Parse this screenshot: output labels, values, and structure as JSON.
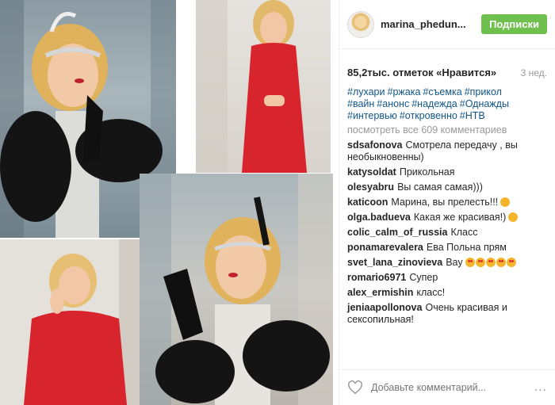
{
  "post": {
    "username": "marina_phedun...",
    "follow_label": "Подписки",
    "likes": "85,2тыс. отметок «Нравится»",
    "date": "3 нед.",
    "hashtags": [
      "#лухари",
      "#ржака",
      "#съемка",
      "#прикол",
      "#вайн",
      "#анонс",
      "#надежда",
      "#Однажды",
      "#интервью",
      "#откровенно",
      "#НТВ"
    ],
    "view_all": "посмотреть все 609 комментариев",
    "comments": [
      {
        "user": "sdsafonova",
        "text": "Смотрела передачу , вы необыкновенны)",
        "emoji": 0
      },
      {
        "user": "katysoldat",
        "text": "Прикольная",
        "emoji": 0
      },
      {
        "user": "olesyabru",
        "text": "Вы самая самая)))",
        "emoji": 0
      },
      {
        "user": "katicoon",
        "text": "Марина, вы прелесть!!!",
        "emoji": 1
      },
      {
        "user": "olga.badueva",
        "text": "Какая же красивая!)",
        "emoji": 1
      },
      {
        "user": "colic_calm_of_russia",
        "text": "Класс",
        "emoji": 0
      },
      {
        "user": "ponamarevalera",
        "text": "Ева Польна прям",
        "emoji": 0
      },
      {
        "user": "svet_lana_zinovieva",
        "text": "Вау",
        "emoji": 5
      },
      {
        "user": "romario6971",
        "text": "Супер",
        "emoji": 0
      },
      {
        "user": "alex_ermishin",
        "text": "класс!",
        "emoji": 0
      },
      {
        "user": "jeniaapollonova",
        "text": "Очень красивая и сексопильная!",
        "emoji": 0
      }
    ],
    "add_comment_placeholder": "Добавьте комментарий...",
    "more_label": "..."
  },
  "colors": {
    "follow_button": "#70c050",
    "hashtag": "#125688",
    "dress_red": "#d8242c"
  },
  "icons": [
    "heart-icon",
    "more-options-icon",
    "avatar"
  ]
}
